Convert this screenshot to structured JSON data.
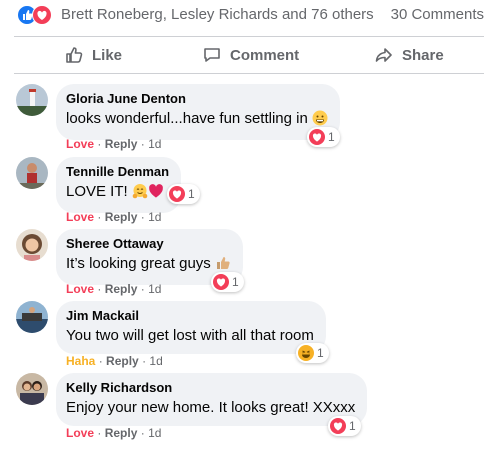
{
  "summary": {
    "names": "Brett Roneberg, Lesley Richards and 76 others",
    "comments_count": "30 Comments",
    "reaction_icons": [
      "like-icon",
      "love-icon"
    ],
    "colors": {
      "like": "#1877f2",
      "love": "#f33e58",
      "haha": "#f7b125"
    }
  },
  "actions": {
    "like_label": "Like",
    "comment_label": "Comment",
    "share_label": "Share"
  },
  "comments": [
    {
      "name": "Gloria June Denton",
      "text": "looks wonderful...have fun settling in",
      "emoji": "grinning-face-icon",
      "reaction_link": "Love",
      "reply": "Reply",
      "sep": "·",
      "time": "1d",
      "reaction_count": "1",
      "reaction_icon": "love-icon"
    },
    {
      "name": "Tennille Denman",
      "text": "LOVE IT!",
      "emoji": "hugging-face-icon, red-heart-icon",
      "reaction_link": "Love",
      "reply": "Reply",
      "sep": "·",
      "time": "1d",
      "reaction_count": "1",
      "reaction_icon": "love-icon"
    },
    {
      "name": "Sheree Ottaway",
      "text": "It’s looking great guys",
      "emoji": "thumbs-up-icon",
      "reaction_link": "Love",
      "reply": "Reply",
      "sep": "·",
      "time": "1d",
      "reaction_count": "1",
      "reaction_icon": "love-icon"
    },
    {
      "name": "Jim Mackail",
      "text": "You two will get lost with all that room",
      "reaction_link": "Haha",
      "reply": "Reply",
      "sep": "·",
      "time": "1d",
      "reaction_count": "1",
      "reaction_icon": "haha-icon"
    },
    {
      "name": "Kelly Richardson",
      "text": "Enjoy your new home. It looks great! XXxxx",
      "reaction_link": "Love",
      "reply": "Reply",
      "sep": "·",
      "time": "1d",
      "reaction_count": "1",
      "reaction_icon": "love-icon"
    }
  ]
}
